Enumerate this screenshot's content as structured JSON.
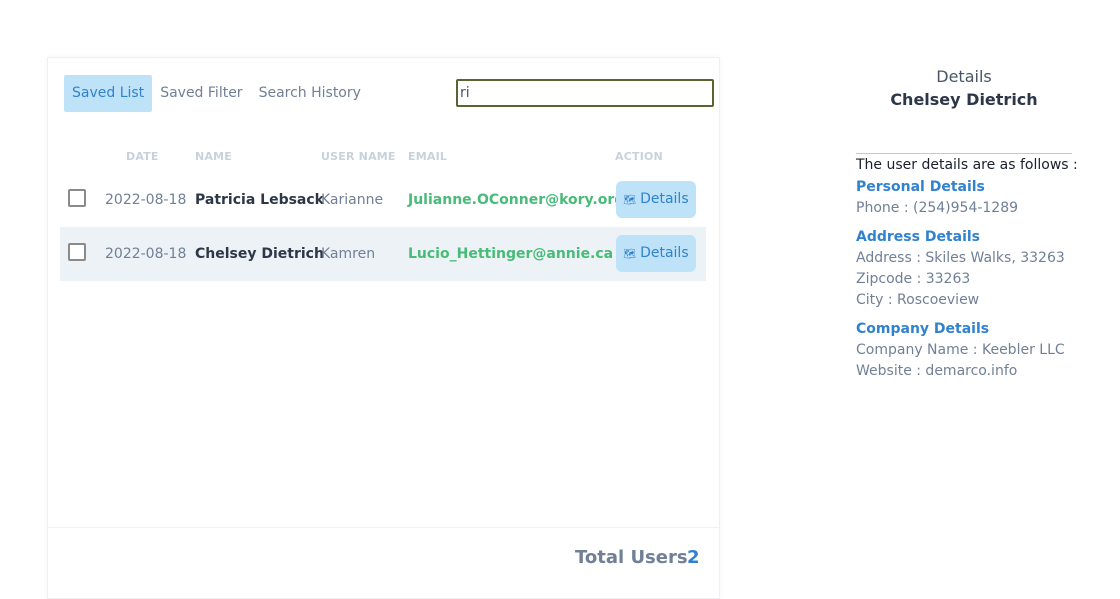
{
  "tabs": [
    "Saved List",
    "Saved Filter",
    "Search History"
  ],
  "search": {
    "value": "ri",
    "placeholder": ""
  },
  "table": {
    "headers": {
      "date": "DATE",
      "name": "NAME",
      "username": "USER NAME",
      "email": "EMAIL",
      "action": "ACTION"
    },
    "rows": [
      {
        "date": "2022-08-18",
        "name": "Patricia Lebsack",
        "username": "Karianne",
        "email": "Julianne.OConner@kory.org",
        "action": "Details"
      },
      {
        "date": "2022-08-18",
        "name": "Chelsey Dietrich",
        "username": "Kamren",
        "email": "Lucio_Hettinger@annie.ca",
        "action": "Details"
      }
    ]
  },
  "footer": {
    "label": "Total Users",
    "value": "2"
  },
  "details": {
    "title": "Details",
    "name": "Chelsey Dietrich",
    "intro": "The user details are as follows :",
    "personal": {
      "heading": "Personal Details",
      "phone": "Phone : (254)954-1289"
    },
    "address": {
      "heading": "Address Details",
      "address": "Address : Skiles Walks, 33263",
      "zipcode": "Zipcode : 33263",
      "city": "City : Roscoeview"
    },
    "company": {
      "heading": "Company Details",
      "name": "Company Name : Keebler LLC",
      "website": "Website : demarco.info"
    }
  },
  "colors": {
    "accent": "#3182ce",
    "accent_bg": "#bee3f8",
    "email": "#48bb78",
    "row_alt": "#edf2f7"
  },
  "icons": {
    "details_button": "map-icon"
  }
}
